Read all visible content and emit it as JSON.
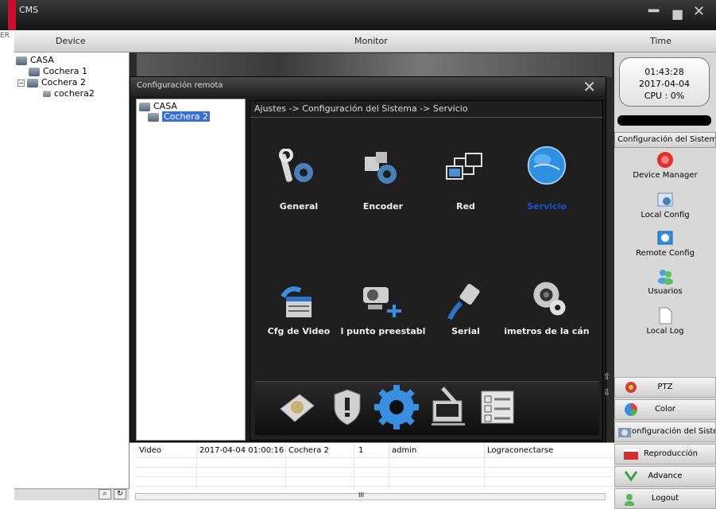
{
  "window": {
    "title": "CMS",
    "minimize": "━",
    "maximize": "■",
    "close": "✕"
  },
  "header": {
    "device": "Device",
    "monitor": "Monitor",
    "time": "Time"
  },
  "device_tree": {
    "root": "CASA",
    "items": [
      "Cochera 1",
      "Cochera 2",
      "cochera2"
    ]
  },
  "edge_char": "ER",
  "remote": {
    "title": "Configuración remota",
    "close": "✕",
    "tree_root": "CASA",
    "tree_item": "Cochera 2",
    "breadcrumb": "Ajustes -> Configuración del Sistema -> Servicio",
    "icons": [
      {
        "label": "General",
        "icon": "wrench-gear-icon"
      },
      {
        "label": "Encoder",
        "icon": "puzzle-gear-icon"
      },
      {
        "label": "Red",
        "icon": "network-icon"
      },
      {
        "label": "Servicio",
        "icon": "globe-icon"
      },
      {
        "label": "Cfg de Video",
        "icon": "video-config-icon"
      },
      {
        "label": "l punto preestabl",
        "icon": "camera-preset-icon"
      },
      {
        "label": "Serial",
        "icon": "serial-cable-icon"
      },
      {
        "label": "imetros de la cán",
        "icon": "camera-settings-icon"
      }
    ],
    "colors": {
      "selected_label": "#1c4fd8",
      "label": "#eeeeee"
    }
  },
  "log": {
    "row": {
      "type": "Video",
      "time": "2017-04-04 01:00:16",
      "device": "Cochera 2",
      "channel": "1",
      "user": "admin",
      "event": "Lograconectarse"
    },
    "scroll_mark": "III"
  },
  "right": {
    "clock_time": "01:43:28",
    "clock_date": "2017-04-04",
    "cpu": "CPU : 0%",
    "syscfg_header": "Configuración del Sistem",
    "buttons": [
      "Device Manager",
      "Local Config",
      "Remote Config",
      "Usuarios",
      "Local Log"
    ],
    "tabs": [
      "PTZ",
      "Color",
      "Configuración del Sistema",
      "Reproducción",
      "Advance",
      "Logout"
    ]
  }
}
